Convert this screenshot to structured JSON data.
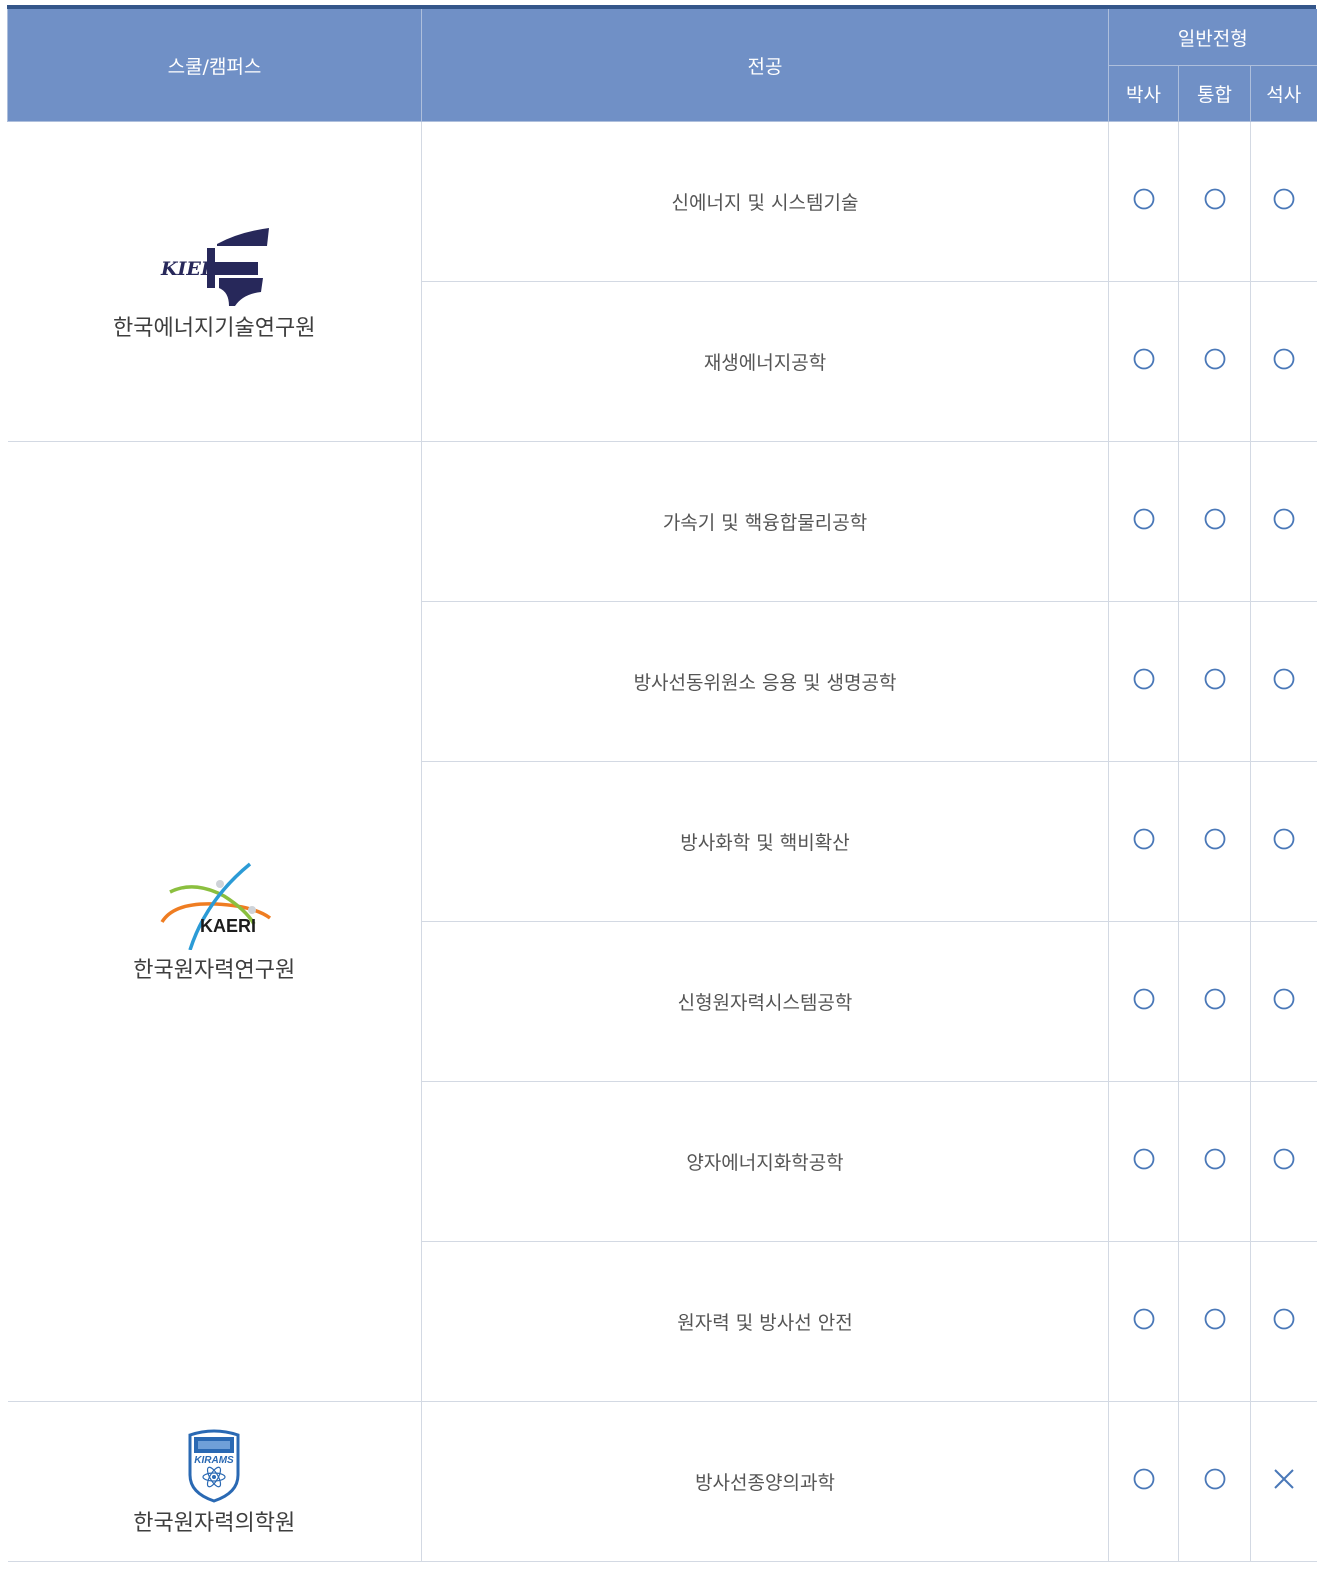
{
  "header": {
    "school_label": "스쿨/캠퍼스",
    "major_label": "전공",
    "admission_label": "일반전형",
    "phd_label": "박사",
    "integrated_label": "통합",
    "masters_label": "석사"
  },
  "schools": [
    {
      "name": "한국에너지기술연구원",
      "logo_text": "KIER",
      "majors": [
        {
          "name": "신에너지 및 시스템기술",
          "phd": "O",
          "integrated": "O",
          "masters": "O"
        },
        {
          "name": "재생에너지공학",
          "phd": "O",
          "integrated": "O",
          "masters": "O"
        }
      ]
    },
    {
      "name": "한국원자력연구원",
      "logo_text": "KAERI",
      "majors": [
        {
          "name": "가속기 및 핵융합물리공학",
          "phd": "O",
          "integrated": "O",
          "masters": "O"
        },
        {
          "name": "방사선동위원소 응용 및 생명공학",
          "phd": "O",
          "integrated": "O",
          "masters": "O"
        },
        {
          "name": "방사화학 및 핵비확산",
          "phd": "O",
          "integrated": "O",
          "masters": "O"
        },
        {
          "name": "신형원자력시스템공학",
          "phd": "O",
          "integrated": "O",
          "masters": "O"
        },
        {
          "name": "양자에너지화학공학",
          "phd": "O",
          "integrated": "O",
          "masters": "O"
        },
        {
          "name": "원자력 및 방사선 안전",
          "phd": "O",
          "integrated": "O",
          "masters": "O"
        }
      ]
    },
    {
      "name": "한국원자력의학원",
      "logo_text": "KIRAMS",
      "majors": [
        {
          "name": "방사선종양의과학",
          "phd": "O",
          "integrated": "O",
          "masters": "X"
        }
      ]
    }
  ]
}
